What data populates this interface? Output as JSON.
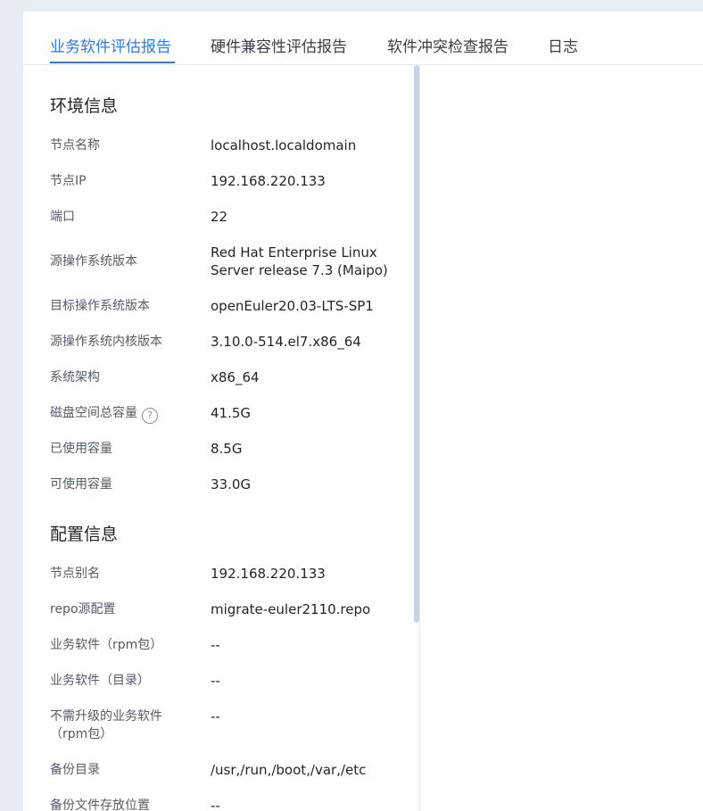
{
  "tabs": [
    {
      "label": "业务软件评估报告",
      "active": true
    },
    {
      "label": "硬件兼容性评估报告",
      "active": false
    },
    {
      "label": "软件冲突检查报告",
      "active": false
    },
    {
      "label": "日志",
      "active": false
    }
  ],
  "environment": {
    "title": "环境信息",
    "rows": [
      {
        "label": "节点名称",
        "value": "localhost.localdomain"
      },
      {
        "label": "节点IP",
        "value": "192.168.220.133"
      },
      {
        "label": "端口",
        "value": "22"
      },
      {
        "label": "源操作系统版本",
        "value": "Red Hat Enterprise Linux Server release 7.3 (Maipo)"
      },
      {
        "label": "目标操作系统版本",
        "value": "openEuler20.03-LTS-SP1"
      },
      {
        "label": "源操作系统内核版本",
        "value": "3.10.0-514.el7.x86_64"
      },
      {
        "label": "系统架构",
        "value": "x86_64"
      },
      {
        "label": "磁盘空间总容量",
        "value": "41.5G",
        "help": "?"
      },
      {
        "label": "已使用容量",
        "value": "8.5G"
      },
      {
        "label": "可使用容量",
        "value": "33.0G"
      }
    ]
  },
  "config": {
    "title": "配置信息",
    "rows": [
      {
        "label": "节点别名",
        "value": "192.168.220.133"
      },
      {
        "label": "repo源配置",
        "value": "migrate-euler2110.repo"
      },
      {
        "label": "业务软件（rpm包）",
        "value": "--"
      },
      {
        "label": "业务软件（目录）",
        "value": "--"
      },
      {
        "label": "不需升级的业务软件（rpm包）",
        "value": "--"
      },
      {
        "label": "备份目录",
        "value": "/usr,/run,/boot,/var,/etc"
      },
      {
        "label": "备份文件存放位置",
        "value": "--"
      }
    ]
  }
}
